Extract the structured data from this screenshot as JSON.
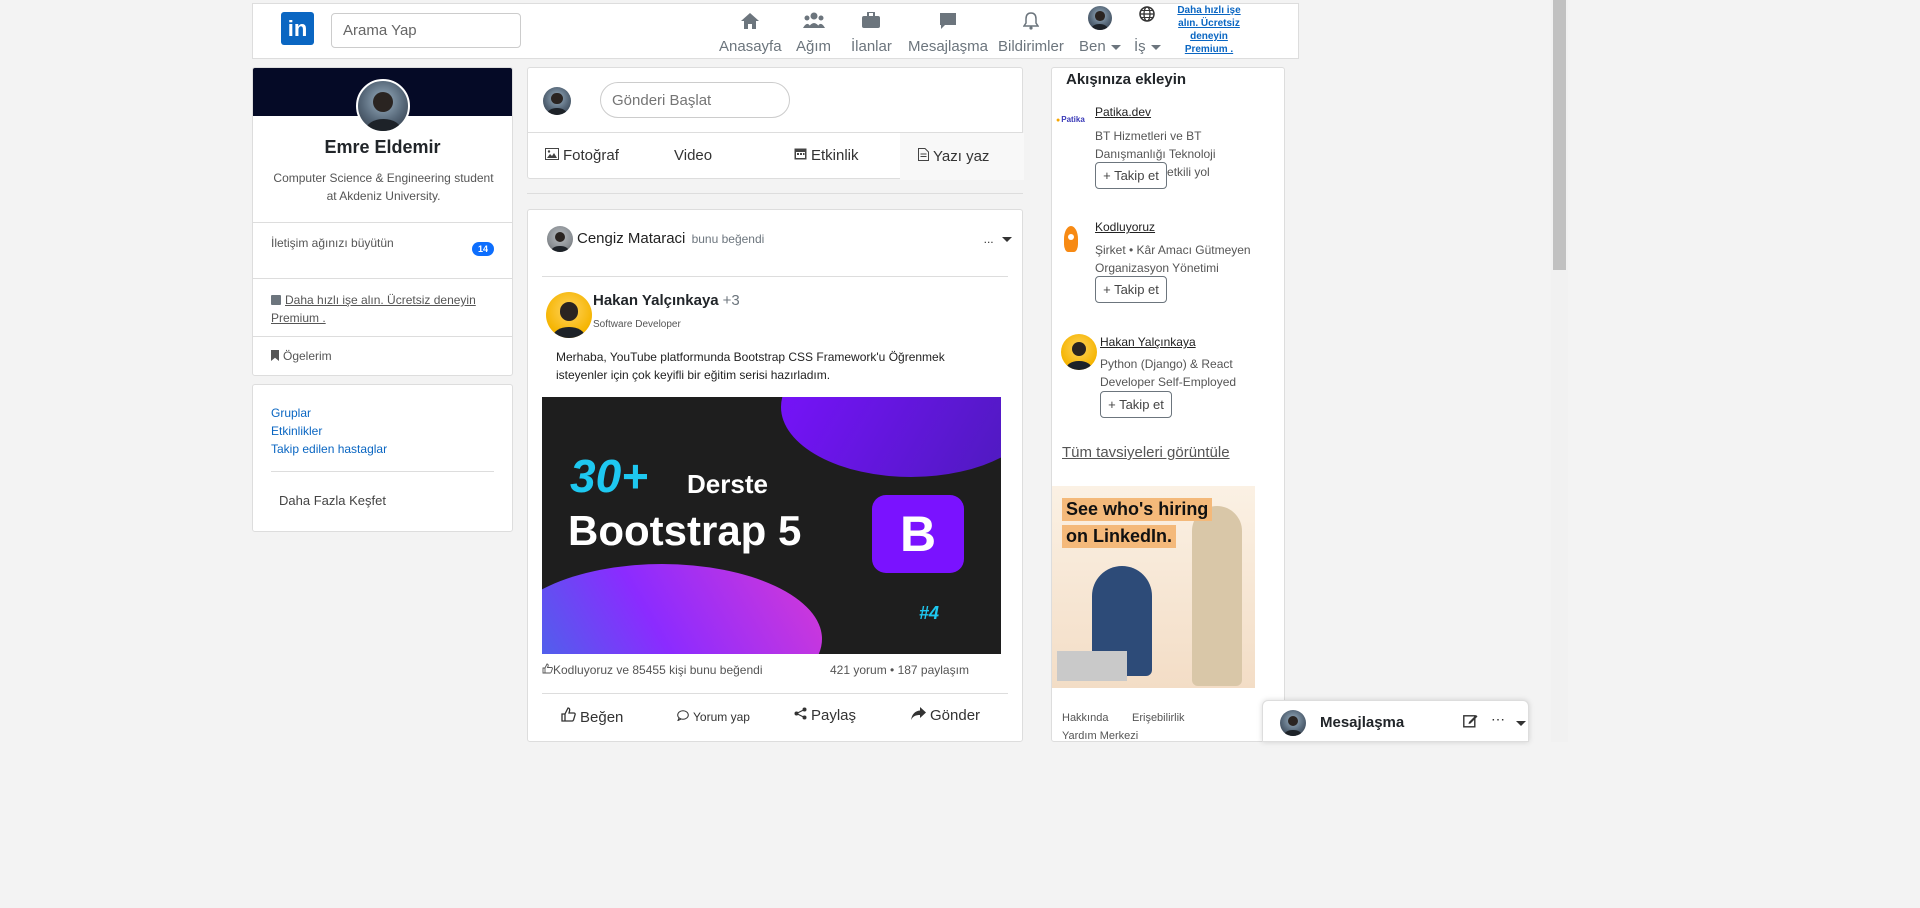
{
  "navbar": {
    "logo_text": "in",
    "search_placeholder": "Arama Yap",
    "items": [
      {
        "label": "Anasayfa",
        "icon": "home-icon"
      },
      {
        "label": "Ağım",
        "icon": "people-icon"
      },
      {
        "label": "İlanlar",
        "icon": "briefcase-icon"
      },
      {
        "label": "Mesajlaşma",
        "icon": "chat-icon"
      },
      {
        "label": "Bildirimler",
        "icon": "bell-icon"
      },
      {
        "label": "Ben",
        "icon": "avatar"
      },
      {
        "label": "İş",
        "icon": "globe-icon"
      }
    ],
    "premium": "Daha hızlı işe alın. Ücretsiz deneyin Premium ."
  },
  "profile": {
    "name": "Emre Eldemir",
    "description": "Computer Science & Engineering student at Akdeniz University.",
    "grow_network": "İletişim ağınızı büyütün",
    "grow_count": "14",
    "premium_text": "Daha hızlı işe alın. Ücretsiz deneyin Premium .",
    "items_label": "Ögelerim"
  },
  "links": {
    "groups": "Gruplar",
    "events": "Etkinlikler",
    "hashtags": "Takip edilen hastaglar",
    "discover": "Daha Fazla Keşfet"
  },
  "share": {
    "placeholder": "Gönderi Başlat",
    "photo": "Fotoğraf",
    "video": "Video",
    "event": "Etkinlik",
    "article": "Yazı yaz"
  },
  "post": {
    "liker_name": "Cengiz Mataraci",
    "liker_suffix": "bunu beğendi",
    "menu": "...",
    "author_name": "Hakan Yalçınkaya",
    "author_plus": "+3",
    "author_title": "Software Developer",
    "text": "Merhaba, YouTube platformunda Bootstrap CSS Framework'u Öğrenmek isteyenler için çok keyifli bir eğitim serisi hazırladım.",
    "image": {
      "line1": "30+",
      "line1b": "Derste",
      "line2": "Bootstrap 5",
      "badge": "B",
      "number": "#4"
    },
    "likes": "Kodluyoruz ve 85455 kişi bunu beğendi",
    "stats": "421 yorum • 187 paylaşım",
    "actions": {
      "like": "Beğen",
      "comment": "Yorum yap",
      "share": "Paylaş",
      "send": "Gönder"
    }
  },
  "suggestions": {
    "title": "Akışınıza ekleyin",
    "items": [
      {
        "name": "Patika.dev",
        "desc": "BT Hizmetleri ve BT Danışmanlığı Teknoloji kariyerine en etkili yol",
        "button": "+ Takip et",
        "logo": "Patika"
      },
      {
        "name": "Kodluyoruz",
        "desc": "Şirket • Kâr Amacı Gütmeyen Organizasyon Yönetimi",
        "button": "+ Takip et"
      },
      {
        "name": "Hakan Yalçınkaya",
        "desc": "Python (Django) & React Developer Self-Employed",
        "button": "+ Takip et"
      }
    ],
    "see_all": "Tüm tavsiyeleri görüntüle",
    "ad": {
      "line1": "See who's hiring",
      "line2": "on LinkedIn."
    },
    "footer": [
      "Hakkında",
      "Erişebilirlik",
      "Yardım Merkezi"
    ]
  },
  "messaging": {
    "title": "Mesajlaşma"
  }
}
